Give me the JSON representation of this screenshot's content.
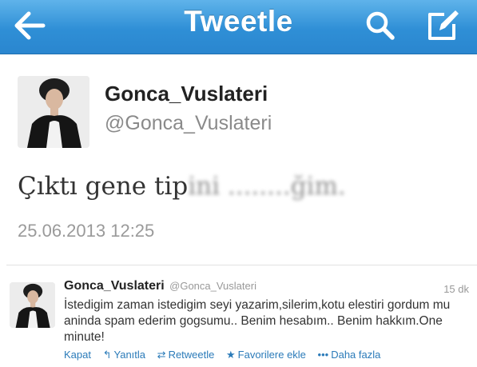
{
  "header": {
    "title": "Tweetle",
    "back_icon": "back-arrow-icon",
    "search_icon": "search-icon",
    "compose_icon": "compose-icon"
  },
  "tweet": {
    "name": "Gonca_Vuslateri",
    "handle": "@Gonca_Vuslateri",
    "text_visible": "Çıktı gene tip",
    "text_blurred": "ini ........ğim.",
    "timestamp": "25.06.2013 12:25"
  },
  "reply": {
    "name": "Gonca_Vuslateri",
    "handle": "@Gonca_Vuslateri",
    "time": "15 dk",
    "text": "İstedigim zaman istedigim seyi yazarim,silerim,kotu elestiri gordum mu aninda spam ederim gogsumu.. Benim hesabım.. Benim hakkım.One minute!",
    "actions": {
      "close": "Kapat",
      "reply": "Yanıtla",
      "retweet": "Retweetle",
      "favorite": "Favorilere ekle",
      "more": "Daha fazla"
    }
  },
  "colors": {
    "header_blue": "#2f8fd6",
    "link_blue": "#2b7bb9"
  }
}
